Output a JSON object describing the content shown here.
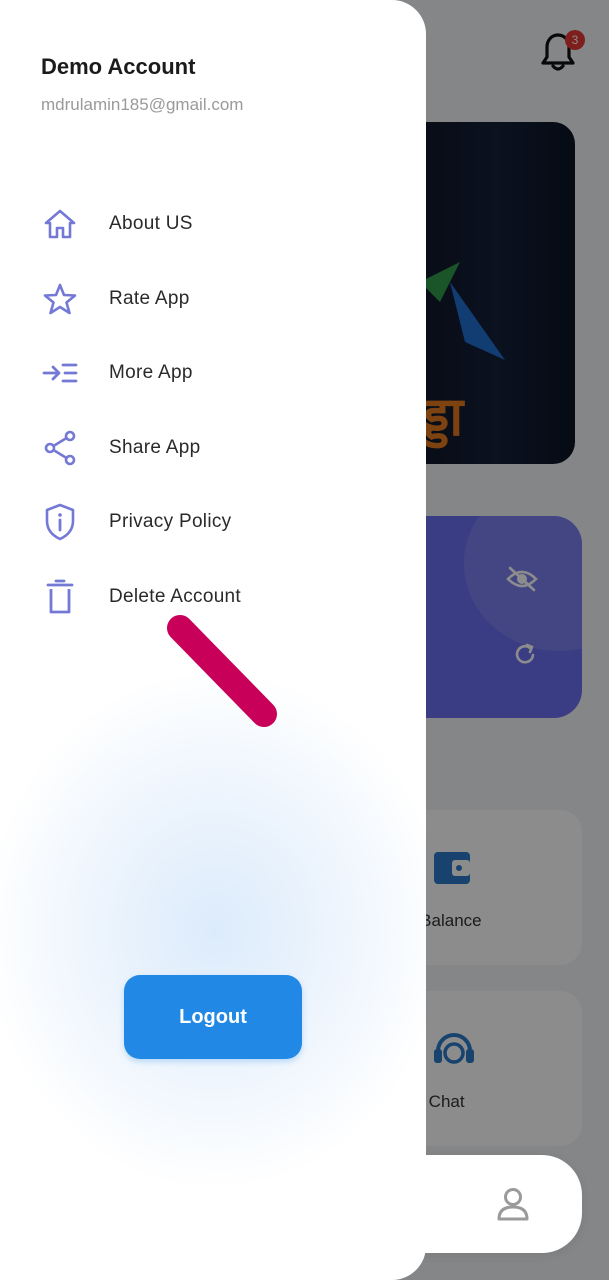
{
  "account": {
    "name": "Demo Account",
    "email": "mdrulamin185@gmail.com"
  },
  "menu": [
    {
      "label": "About US",
      "icon": "home-outline-icon"
    },
    {
      "label": "Rate App",
      "icon": "star-icon"
    },
    {
      "label": "More App",
      "icon": "more-app-icon"
    },
    {
      "label": "Share App",
      "icon": "share-icon"
    },
    {
      "label": "Privacy Policy",
      "icon": "shield-info-icon"
    },
    {
      "label": "Delete Account",
      "icon": "trash-icon"
    }
  ],
  "logout_label": "Logout",
  "background": {
    "notification_count": "3",
    "banner_text": "ड्डा",
    "tiles": [
      {
        "label": "d Balance",
        "icon": "wallet-icon"
      },
      {
        "label": "ve Chat",
        "icon": "headset-icon"
      }
    ]
  },
  "bottom_nav": [
    {
      "icon": "home-icon",
      "active": true
    },
    {
      "icon": "ticket-icon",
      "active": false
    },
    {
      "icon": "bar-chart-icon",
      "active": false
    },
    {
      "icon": "user-icon",
      "active": false
    }
  ],
  "colors": {
    "accent": "#5a5fd8",
    "menu_icon": "#7479d6",
    "logout": "#2188e6",
    "annotation_stroke": "#c8005a"
  }
}
